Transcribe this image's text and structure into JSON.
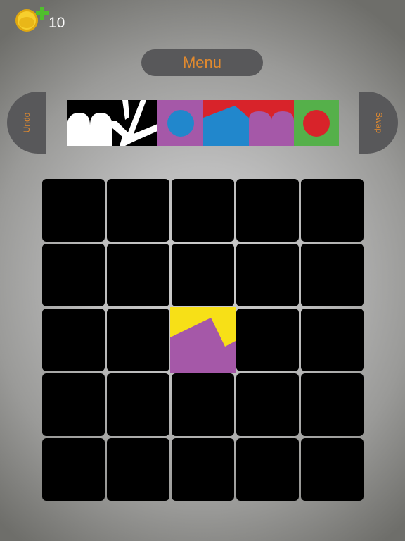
{
  "hud": {
    "coin_count": "10",
    "icons": [
      "coin-icon",
      "plus-icon"
    ]
  },
  "buttons": {
    "menu": "Menu",
    "undo": "Undo",
    "swap": "Swap"
  },
  "colors": {
    "accent": "#e28a2e",
    "button_bg": "#58585a",
    "tile": "#000000",
    "yellow": "#f7e017",
    "purple": "#a558a8",
    "blue": "#2187cc",
    "red": "#d8232a",
    "green": "#55b04a",
    "white": "#ffffff"
  },
  "strip_pieces": [
    {
      "name": "white-arches-piece",
      "pattern": "white-arches-on-black"
    },
    {
      "name": "white-branches-piece",
      "pattern": "white-branches-on-black"
    },
    {
      "name": "blue-dot-piece",
      "pattern": "blue-circle-on-purple"
    },
    {
      "name": "blue-red-wave-piece",
      "pattern": "blue-and-red-on-purple"
    },
    {
      "name": "purple-arches-piece",
      "pattern": "purple-arches-on-red"
    },
    {
      "name": "red-dot-piece",
      "pattern": "red-circle-on-green"
    }
  ],
  "board": {
    "rows": 5,
    "cols": 5,
    "placed": [
      {
        "row": 2,
        "col": 2,
        "pattern": "purple-over-yellow"
      }
    ]
  }
}
